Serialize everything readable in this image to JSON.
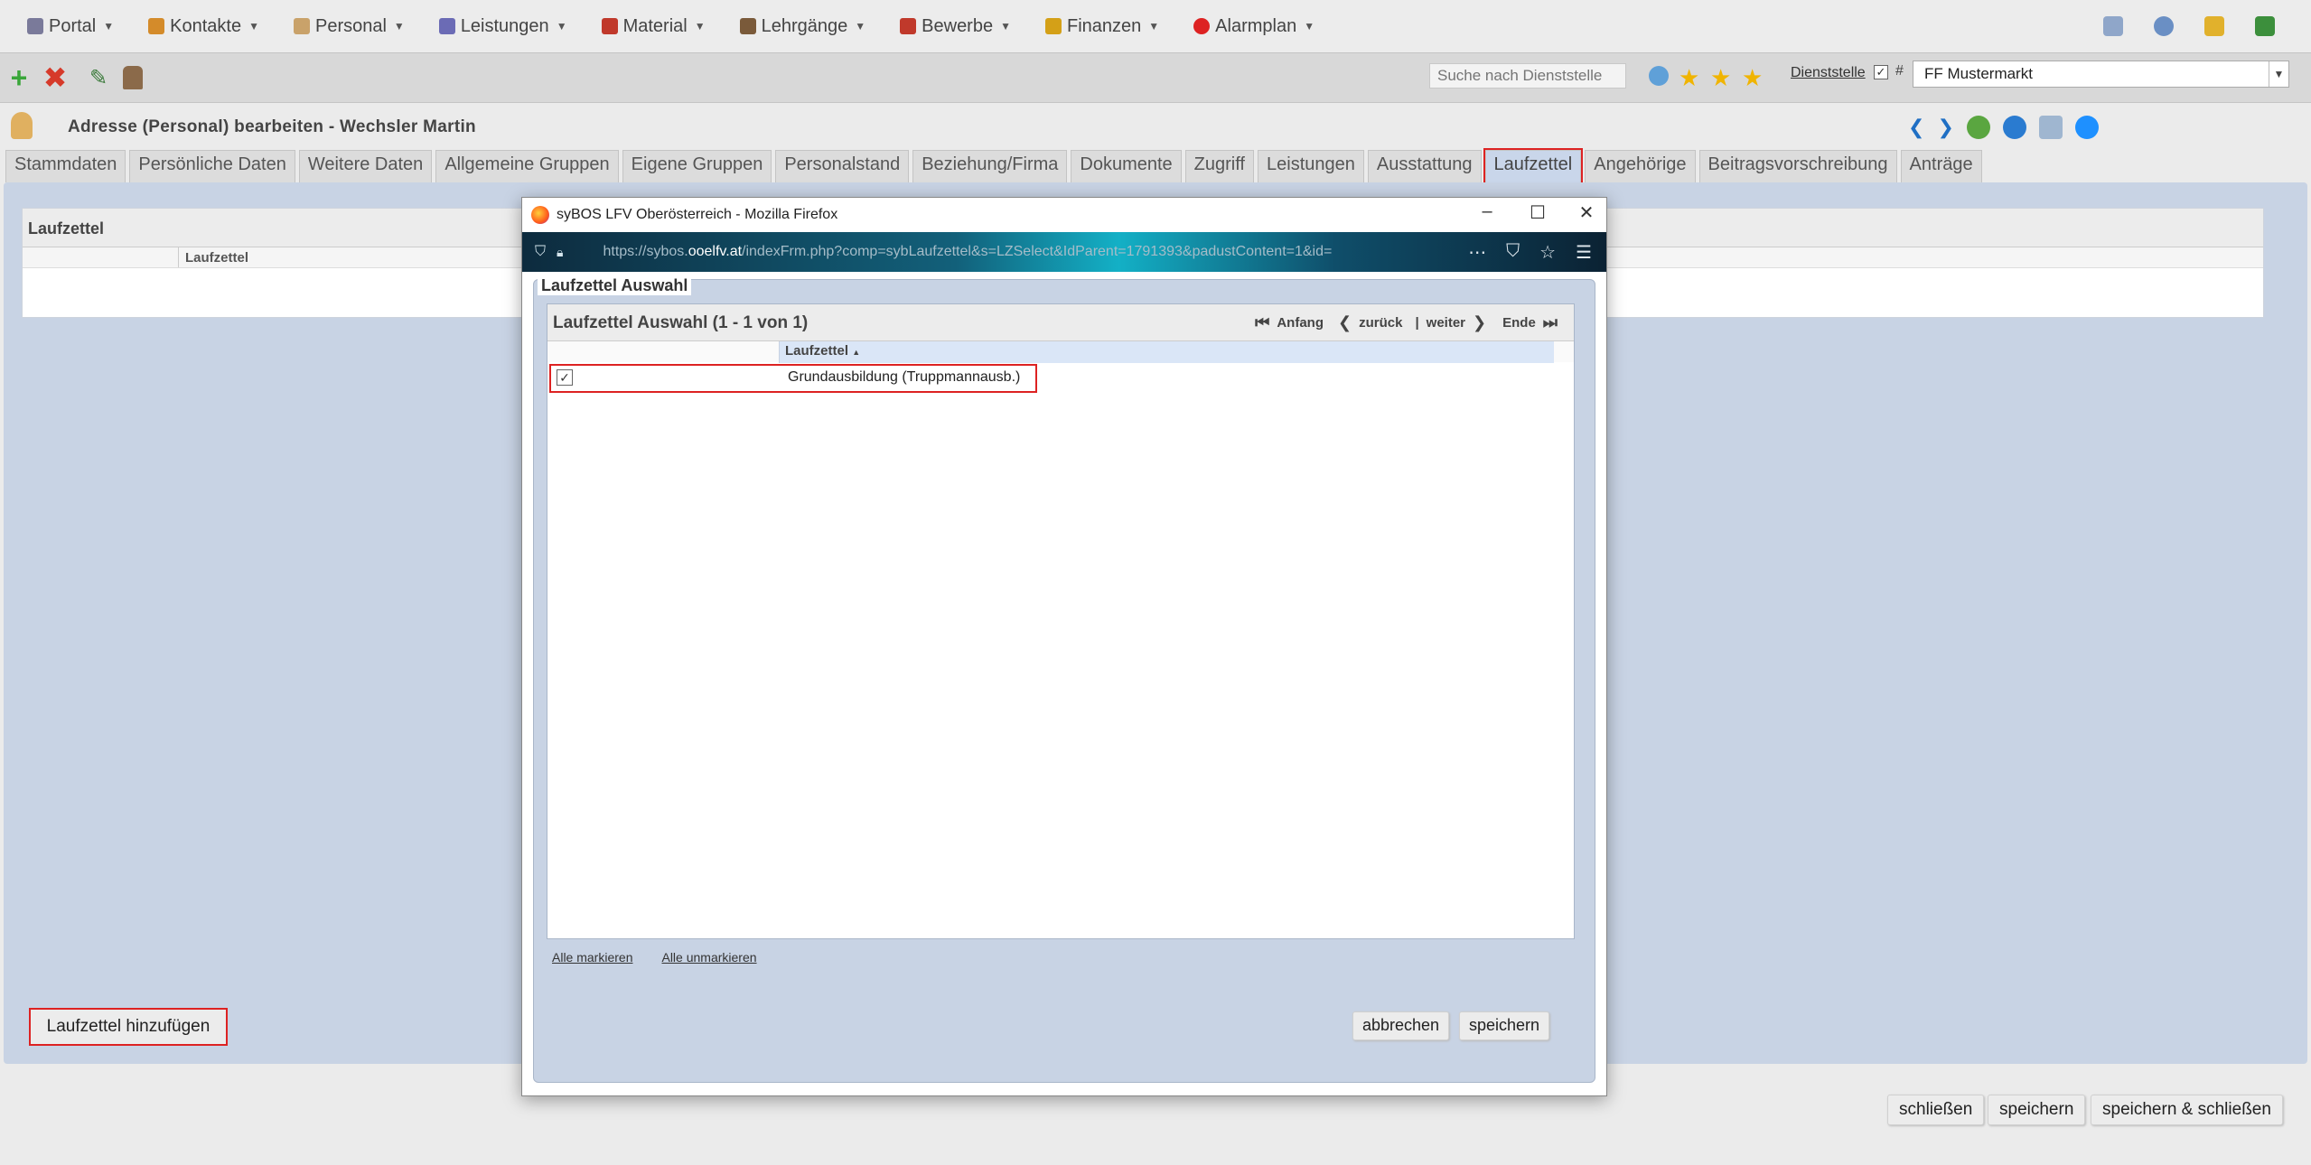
{
  "menubar": {
    "items": [
      {
        "label": "Portal",
        "icon": "portal-icon",
        "color": "#7a7a9a"
      },
      {
        "label": "Kontakte",
        "icon": "contacts-icon",
        "color": "#d48b2a"
      },
      {
        "label": "Personal",
        "icon": "person-icon",
        "color": "#c9a26a"
      },
      {
        "label": "Leistungen",
        "icon": "services-icon",
        "color": "#6b6bb5"
      },
      {
        "label": "Material",
        "icon": "truck-icon",
        "color": "#c0392b"
      },
      {
        "label": "Lehrgänge",
        "icon": "course-icon",
        "color": "#7a5a3a"
      },
      {
        "label": "Bewerbe",
        "icon": "competition-icon",
        "color": "#c0392b"
      },
      {
        "label": "Finanzen",
        "icon": "money-icon",
        "color": "#d4a017"
      },
      {
        "label": "Alarmplan",
        "icon": "alarm-icon",
        "color": "#d22"
      }
    ]
  },
  "toolbar": {
    "search_placeholder": "Suche nach Dienststelle",
    "dienststelle_label": "Dienststelle",
    "dienststelle_checked": "✓",
    "hash": "#",
    "dienststelle_value": "FF Mustermarkt"
  },
  "title": "Adresse (Personal) bearbeiten - Wechsler Martin",
  "tabs": [
    "Stammdaten",
    "Persönliche Daten",
    "Weitere Daten",
    "Allgemeine Gruppen",
    "Eigene Gruppen",
    "Personalstand",
    "Beziehung/Firma",
    "Dokumente",
    "Zugriff",
    "Leistungen",
    "Ausstattung",
    "Laufzettel",
    "Angehörige",
    "Beitragsvorschreibung",
    "Anträge"
  ],
  "laufzettel_panel": {
    "title": "Laufzettel",
    "column": "Laufzettel",
    "add_button": "Laufzettel hinzufügen"
  },
  "bottom_buttons": {
    "close": "schließen",
    "save": "speichern",
    "save_close": "speichern & schließen"
  },
  "popup": {
    "window_title": "syBOS LFV Oberösterreich - Mozilla Firefox",
    "url_prefix": "https://sybos.",
    "url_host": "ooelfv.at",
    "url_rest": "/indexFrm.php?comp=sybLaufzettel&s=LZSelect&IdParent=1791393&padustContent=1&id=",
    "panel_title": "Laufzettel Auswahl",
    "grid_title": "Laufzettel Auswahl (1 - 1 von 1)",
    "pager": {
      "first": "Anfang",
      "prev": "zurück",
      "sep": "|",
      "next": "weiter",
      "last": "Ende"
    },
    "column": "Laufzettel",
    "sort_indicator": "▲",
    "rows": [
      {
        "checked": "✓",
        "label": "Grundausbildung (Truppmannausb.)"
      }
    ],
    "mark_all": "Alle markieren",
    "unmark_all": "Alle unmarkieren",
    "cancel": "abbrechen",
    "save": "speichern"
  }
}
